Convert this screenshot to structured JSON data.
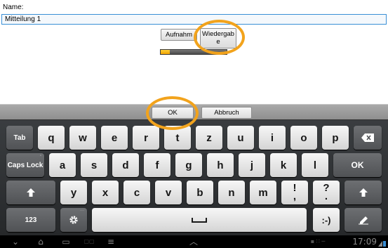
{
  "form": {
    "name_label": "Name:",
    "name_value": "Mitteilung 1",
    "record_label": "Aufnahm",
    "play_label": "Wiedergabe",
    "progress": 0.14
  },
  "actions": {
    "ok_label": "OK",
    "cancel_label": "Abbruch"
  },
  "keyboard": {
    "row1": [
      "Tab",
      "q",
      "w",
      "e",
      "r",
      "t",
      "z",
      "u",
      "i",
      "o",
      "p",
      "backspace-icon"
    ],
    "row2": [
      "Caps Lock",
      "a",
      "s",
      "d",
      "f",
      "g",
      "h",
      "j",
      "k",
      "l",
      "OK"
    ],
    "row3": [
      "shift-icon",
      "y",
      "x",
      "c",
      "v",
      "b",
      "n",
      "m",
      "!",
      "?",
      "shift-icon"
    ],
    "row4": [
      "123",
      "settings-icon",
      "space-icon",
      ":-)",
      "handwriting-icon"
    ],
    "tab": "Tab",
    "caps": "Caps Lock",
    "enter": "OK",
    "numbers": "123",
    "smiley": ":-)",
    "excl_top": "!",
    "excl_bottom": ",",
    "quest_top": "?",
    "quest_bottom": ".",
    "space_glyph": "␣"
  },
  "statusbar": {
    "time": "17:09"
  },
  "colors": {
    "highlight": "#f2a31c",
    "progress_fill": "#ffb700",
    "input_border": "#3a8fd6"
  }
}
